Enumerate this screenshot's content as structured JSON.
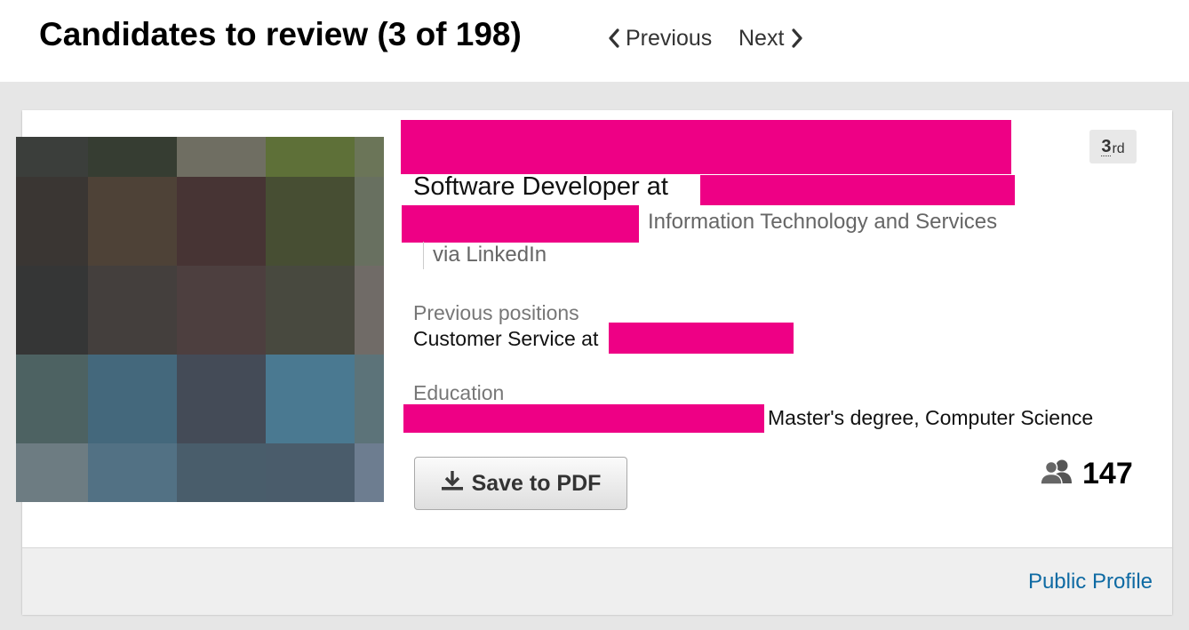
{
  "header": {
    "title": "Candidates to review (3 of 198)",
    "previous_label": "Previous",
    "next_label": "Next",
    "icons": {
      "previous": "chevron-left-icon",
      "next": "chevron-right-icon"
    }
  },
  "candidate": {
    "headline": "Software Developer at",
    "industry": "Information Technology and Services",
    "source": "via LinkedIn",
    "connection_degree": "3",
    "connection_degree_suffix": "rd",
    "previous_positions": {
      "label": "Previous positions",
      "value": "Customer Service at"
    },
    "education": {
      "label": "Education",
      "value": "Master's degree, Computer Science"
    },
    "connections_count": "147",
    "save_button_label": "Save to PDF",
    "public_profile_label": "Public Profile",
    "icons": {
      "save": "download-icon",
      "connections": "people-icon"
    }
  },
  "colors": {
    "redaction": "#ee0085",
    "link": "#0e6aa3",
    "header_background": "#ffffff",
    "page_background": "#e6e6e6"
  },
  "photo_pixels": [
    [
      "#3b3e3b",
      "#363d32",
      "#6f6e62",
      "#5e7038",
      "#6b7558"
    ],
    [
      "#3a3633",
      "#4e4237",
      "#473434",
      "#474e33",
      "#687060"
    ],
    [
      "#353636",
      "#443f3d",
      "#4d3f3f",
      "#48493f",
      "#706b67"
    ],
    [
      "#4d6262",
      "#44687c",
      "#444b57",
      "#4a7991",
      "#5c7379"
    ],
    [
      "#6d7c82",
      "#527184",
      "#495d6b",
      "#4a5c6b",
      "#6d7d90"
    ]
  ]
}
